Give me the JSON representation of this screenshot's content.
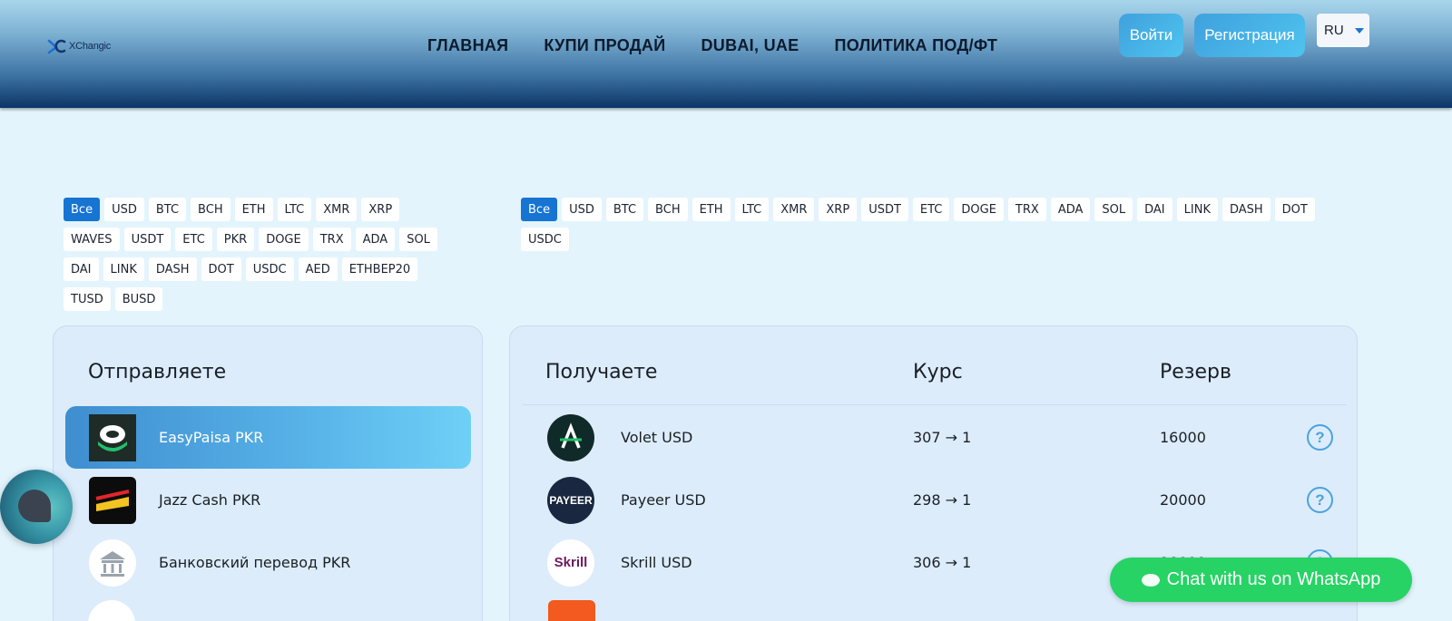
{
  "header": {
    "logo_text": "XChangic",
    "nav": [
      "ГЛАВНАЯ",
      "КУПИ ПРОДАЙ",
      "DUBAI, UAE",
      "ПОЛИТИКА ПОД/ФТ"
    ],
    "login_label": "Войти",
    "register_label": "Регистрация",
    "language": "RU"
  },
  "filters_left": [
    "Все",
    "USD",
    "BTC",
    "BCH",
    "ETH",
    "LTC",
    "XMR",
    "XRP",
    "WAVES",
    "USDT",
    "ETC",
    "PKR",
    "DOGE",
    "TRX",
    "ADA",
    "SOL",
    "DAI",
    "LINK",
    "DASH",
    "DOT",
    "USDC",
    "AED",
    "ETHBEP20",
    "TUSD",
    "BUSD"
  ],
  "filters_right": [
    "Все",
    "USD",
    "BTC",
    "BCH",
    "ETH",
    "LTC",
    "XMR",
    "XRP",
    "USDT",
    "ETC",
    "DOGE",
    "TRX",
    "ADA",
    "SOL",
    "DAI",
    "LINK",
    "DASH",
    "DOT",
    "USDC"
  ],
  "send_panel": {
    "title": "Отправляете",
    "items": [
      {
        "label": "EasyPaisa PKR",
        "selected": true,
        "icon": "easypaisa-icon"
      },
      {
        "label": "Jazz Cash PKR",
        "selected": false,
        "icon": "jazzcash-icon"
      },
      {
        "label": "Банковский перевод PKR",
        "selected": false,
        "icon": "bank-icon"
      }
    ]
  },
  "receive_panel": {
    "title": "Получаете",
    "rate_header": "Курс",
    "reserve_header": "Резерв",
    "items": [
      {
        "label": "Volet USD",
        "rate": "307 → 1",
        "reserve": "16000",
        "icon": "volet-icon"
      },
      {
        "label": "Payeer USD",
        "rate": "298 → 1",
        "reserve": "20000",
        "icon": "payeer-icon",
        "icon_text": "PAYEER"
      },
      {
        "label": "Skrill USD",
        "rate": "306 → 1",
        "reserve": "18000",
        "icon": "skrill-icon",
        "icon_text": "Skrill"
      }
    ]
  },
  "help_symbol": "?",
  "whatsapp_label": "Chat with us on WhatsApp",
  "colors": {
    "accent": "#1674d3",
    "button": "#4fc3ef",
    "whatsapp": "#27d365",
    "page_bg": "#e3f4fd"
  }
}
